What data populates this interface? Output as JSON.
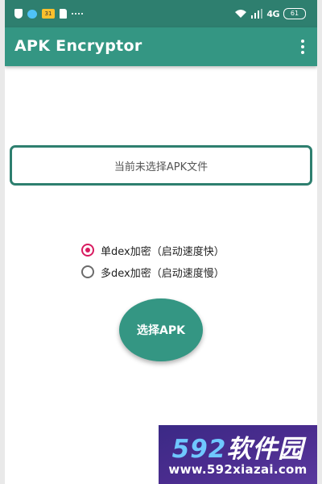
{
  "status_bar": {
    "calendar_day": "31",
    "network_type": "4G",
    "battery_level": "61",
    "icons": [
      "shield-icon",
      "bubble-icon",
      "calendar-icon",
      "sd-card-icon",
      "dots-icon",
      "wifi-icon",
      "signal-icon",
      "battery-icon"
    ]
  },
  "app_bar": {
    "title": "APK Encryptor",
    "menu_icon": "overflow-menu-icon"
  },
  "file_display": {
    "text": "当前未选择APK文件"
  },
  "options": [
    {
      "label": "单dex加密（启动速度快）",
      "selected": true
    },
    {
      "label": "多dex加密（启动速度慢）",
      "selected": false
    }
  ],
  "choose_button": {
    "label": "选择APK"
  },
  "watermark": {
    "brand_num": "592",
    "brand_cn": "软件园",
    "url": "www.592xiazai.com"
  },
  "colors": {
    "primary": "#349683",
    "primary_dark": "#2e7f6f",
    "accent": "#d81b60"
  }
}
